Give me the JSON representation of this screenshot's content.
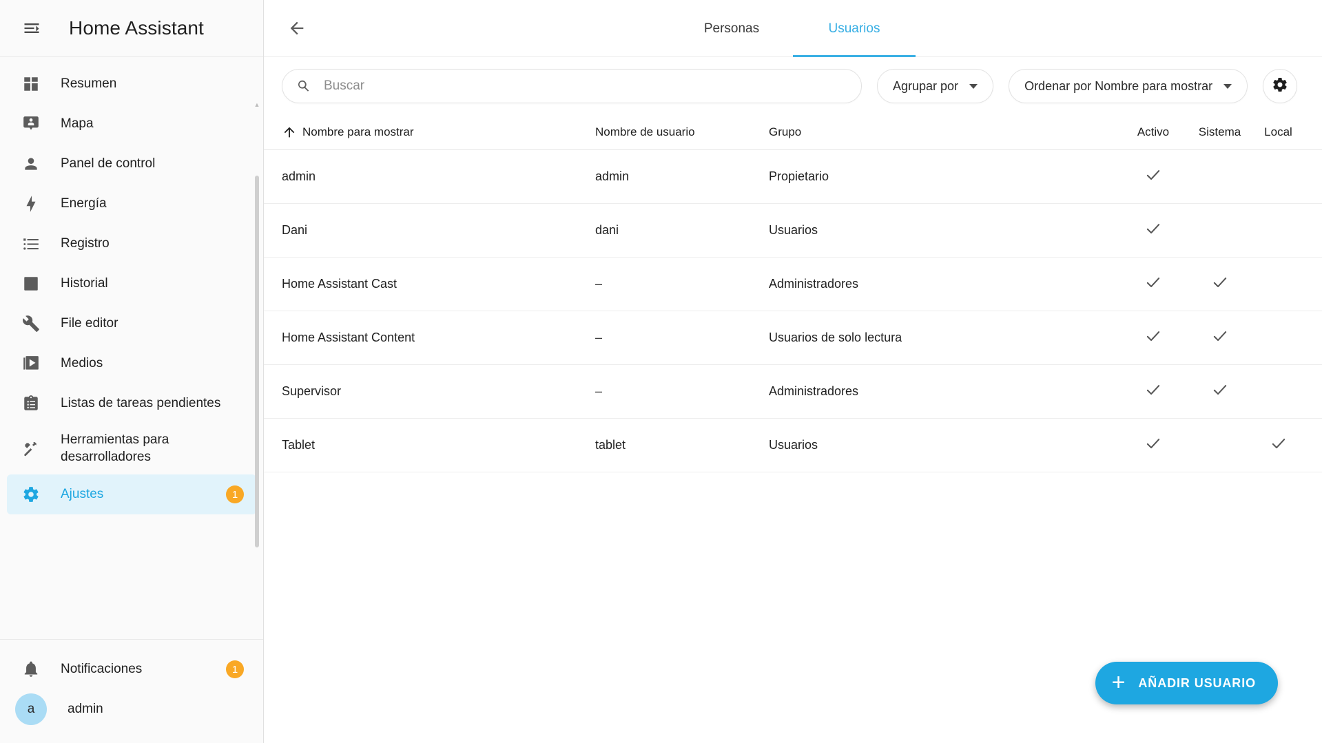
{
  "sidebar": {
    "title": "Home Assistant",
    "menu_icon": "menu-collapse-icon",
    "items": [
      {
        "label": "Resumen",
        "icon": "view-dashboard-icon",
        "badge": ""
      },
      {
        "label": "Mapa",
        "icon": "map-marker-account-icon",
        "badge": ""
      },
      {
        "label": "Panel de control",
        "icon": "account-icon",
        "badge": ""
      },
      {
        "label": "Energía",
        "icon": "lightning-bolt-icon",
        "badge": ""
      },
      {
        "label": "Registro",
        "icon": "format-list-bulleted-icon",
        "badge": ""
      },
      {
        "label": "Historial",
        "icon": "chart-box-icon",
        "badge": ""
      },
      {
        "label": "File editor",
        "icon": "wrench-icon",
        "badge": ""
      },
      {
        "label": "Medios",
        "icon": "play-box-multiple-icon",
        "badge": ""
      },
      {
        "label": "Listas de tareas pendientes",
        "icon": "clipboard-list-icon",
        "badge": ""
      },
      {
        "label": "Herramientas para desarrolladores",
        "icon": "hammer-wrench-icon",
        "badge": ""
      },
      {
        "label": "Ajustes",
        "icon": "cog-icon",
        "badge": "1"
      }
    ],
    "footer": {
      "notifications_label": "Notificaciones",
      "notifications_icon": "bell-icon",
      "notifications_badge": "1",
      "user_label": "admin",
      "user_initial": "a"
    },
    "accent_color": "#1ea7e1",
    "badge_color": "#f9a825",
    "active_bg": "#e1f3fb"
  },
  "topbar": {
    "back_icon": "arrow-left-icon",
    "tabs": [
      {
        "label": "Personas",
        "active": false
      },
      {
        "label": "Usuarios",
        "active": true
      }
    ]
  },
  "toolbar": {
    "search_placeholder": "Buscar",
    "search_value": "",
    "search_icon": "search-icon",
    "group_by_label": "Agrupar por",
    "sort_by_label": "Ordenar por Nombre para mostrar",
    "settings_icon": "gear-icon"
  },
  "table": {
    "sort_icon": "arrow-up-icon",
    "columns": [
      "Nombre para mostrar",
      "Nombre de usuario",
      "Grupo",
      "Activo",
      "Sistema",
      "Local"
    ],
    "rows": [
      {
        "name": "admin",
        "username": "admin",
        "group": "Propietario",
        "activo": "✓",
        "sistema": "",
        "local": ""
      },
      {
        "name": "Dani",
        "username": "dani",
        "group": "Usuarios",
        "activo": "✓",
        "sistema": "",
        "local": ""
      },
      {
        "name": "Home Assistant Cast",
        "username": "–",
        "group": "Administradores",
        "activo": "✓",
        "sistema": "✓",
        "local": ""
      },
      {
        "name": "Home Assistant Content",
        "username": "–",
        "group": "Usuarios de solo lectura",
        "activo": "✓",
        "sistema": "✓",
        "local": ""
      },
      {
        "name": "Supervisor",
        "username": "–",
        "group": "Administradores",
        "activo": "✓",
        "sistema": "✓",
        "local": ""
      },
      {
        "name": "Tablet",
        "username": "tablet",
        "group": "Usuarios",
        "activo": "✓",
        "sistema": "",
        "local": "✓"
      }
    ]
  },
  "fab": {
    "label": "AÑADIR USUARIO",
    "icon": "plus-icon",
    "color": "#1ea7e1"
  }
}
